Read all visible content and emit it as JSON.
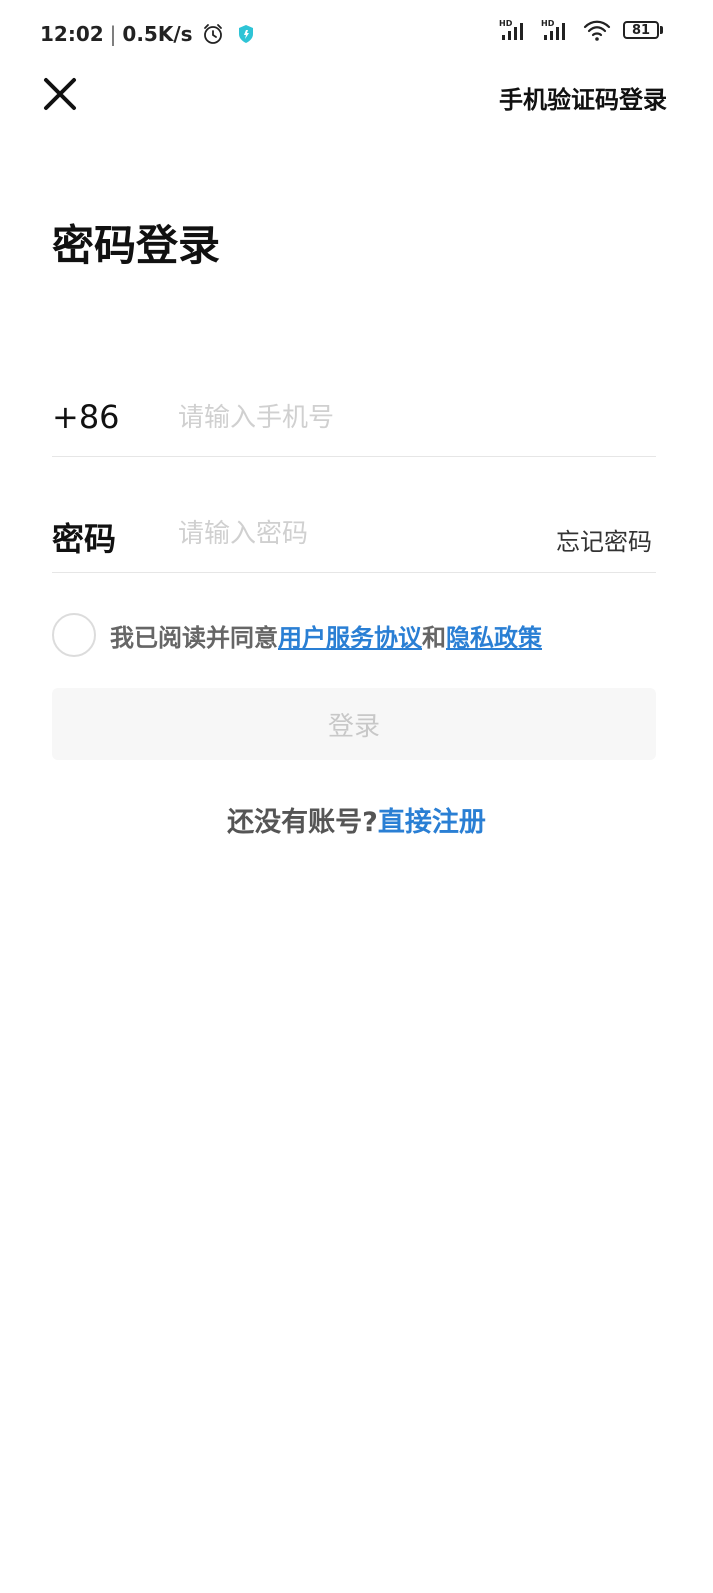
{
  "status_bar": {
    "time": "12:02",
    "separator": "|",
    "net_speed": "0.5K/s",
    "battery_level": "81",
    "icons": [
      "alarm-icon",
      "shield-icon",
      "signal-hd-icon",
      "signal-hd-icon",
      "wifi-icon",
      "battery-icon"
    ],
    "shield_color": "#2ec4d6"
  },
  "nav": {
    "sms_login_label": "手机验证码登录",
    "close_icon": "close-icon"
  },
  "page": {
    "title": "密码登录"
  },
  "form": {
    "phone": {
      "country_code": "+86",
      "placeholder": "请输入手机号",
      "value": ""
    },
    "password": {
      "label": "密码",
      "placeholder": "请输入密码",
      "value": "",
      "forgot_label": "忘记密码"
    },
    "agreement": {
      "checked": false,
      "prefix": "我已阅读并同意",
      "terms_label": "用户服务协议",
      "conjunction": "和",
      "privacy_label": "隐私政策"
    },
    "login_button_label": "登录"
  },
  "register": {
    "prompt": "还没有账号?",
    "link_label": "直接注册"
  },
  "colors": {
    "link": "#2a7fd4",
    "disabled_button_bg": "#f7f7f7",
    "disabled_button_text": "#c8c8c8",
    "placeholder": "#d0d0d0"
  }
}
